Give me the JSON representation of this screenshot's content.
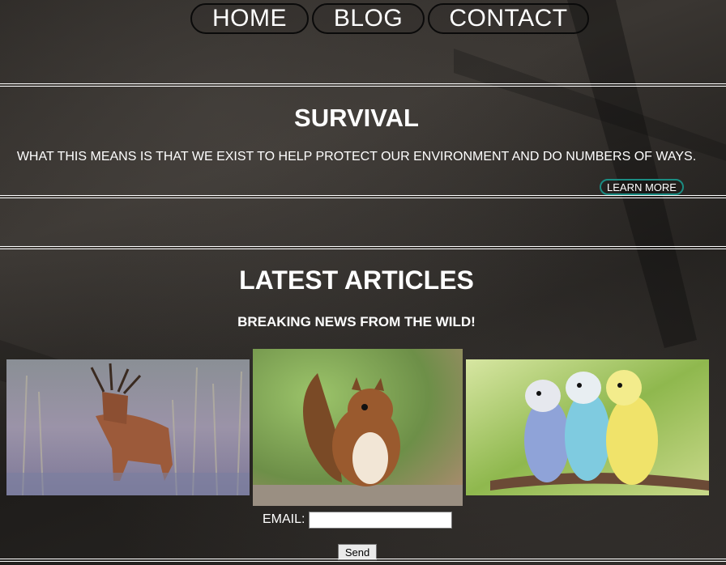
{
  "nav": {
    "home": "HOME",
    "blog": "BLOG",
    "contact": "CONTACT"
  },
  "survival": {
    "title": "SURVIVAL",
    "text": "WHAT THIS MEANS IS THAT WE EXIST TO HELP PROTECT OUR ENVIRONMENT AND DO NUMBERS OF WAYS.",
    "learn_more": "LEARN MORE"
  },
  "articles": {
    "title": "LATEST ARTICLES",
    "subtitle": "BREAKING NEWS FROM THE WILD!",
    "images": [
      "deer-photo",
      "squirrel-photo",
      "parakeets-photo"
    ]
  },
  "form": {
    "email_label": "EMAIL:",
    "email_value": "",
    "send_label": "Send"
  },
  "colors": {
    "accent": "#1b8c82",
    "text": "#ffffff",
    "background": "#2c2926"
  }
}
